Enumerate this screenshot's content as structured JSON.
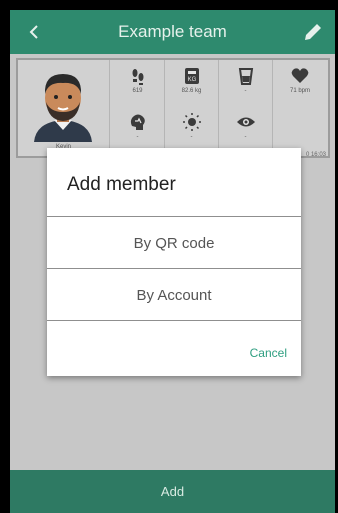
{
  "header": {
    "title": "Example team",
    "back_icon": "chevron-left-icon",
    "edit_icon": "pencil-icon"
  },
  "member_card": {
    "name": "Kevin",
    "time": "0 16:03",
    "metrics": [
      {
        "icon": "footsteps-icon",
        "value": "619"
      },
      {
        "icon": "scale-icon",
        "value": "82.6 kg"
      },
      {
        "icon": "cup-icon",
        "value": "-"
      },
      {
        "icon": "heart-icon",
        "value": "71 bpm"
      },
      {
        "icon": "brain-icon",
        "value": "-"
      },
      {
        "icon": "sun-icon",
        "value": "-"
      },
      {
        "icon": "eye-icon",
        "value": "-"
      }
    ]
  },
  "dialog": {
    "title": "Add member",
    "options": [
      "By QR code",
      "By Account"
    ],
    "cancel_label": "Cancel"
  },
  "footer": {
    "add_label": "Add"
  },
  "colors": {
    "primary": "#2e8a6e",
    "accent": "#2e9e80",
    "scrim": "#c7c7c7"
  }
}
